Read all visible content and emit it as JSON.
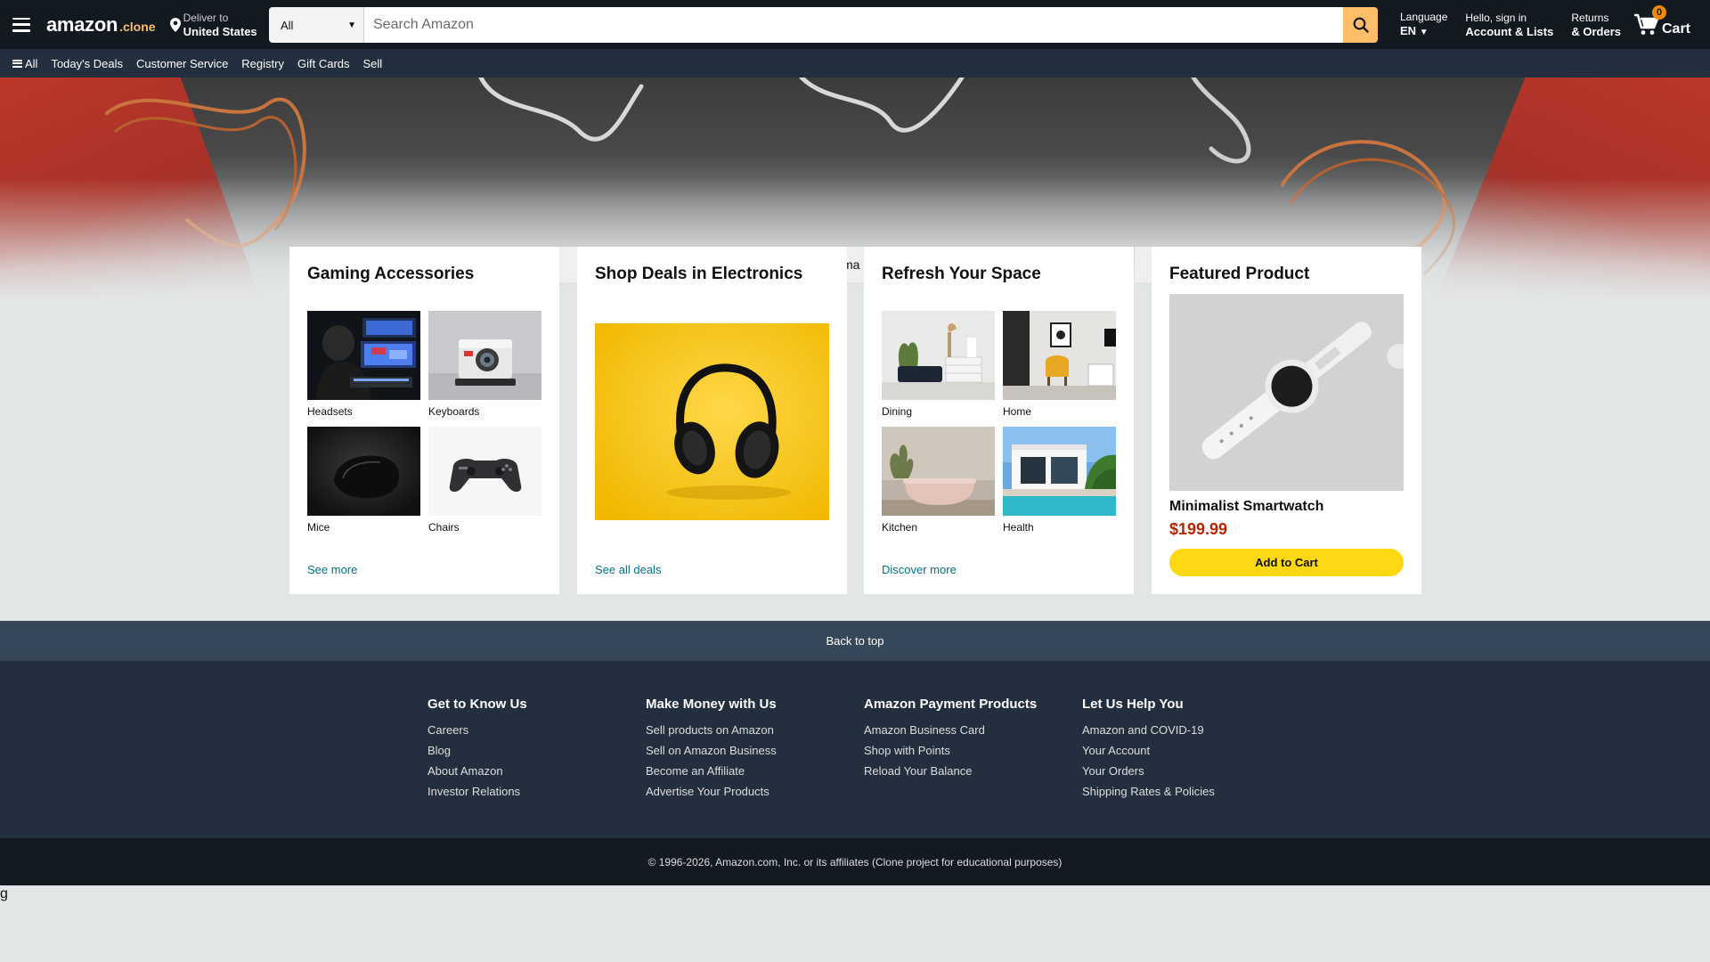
{
  "header": {
    "logo_word": "amazon",
    "logo_suffix": ".clone",
    "deliver_line1": "Deliver to",
    "deliver_line2": "United States",
    "search_category": "All",
    "search_placeholder": "Search Amazon",
    "language_line1": "Language",
    "language_line2": "EN",
    "account_line1": "Hello, sign in",
    "account_line2": "Account & Lists",
    "returns_line1": "Returns",
    "returns_line2": "& Orders",
    "cart_count": "0",
    "cart_label": "Cart"
  },
  "subnav": {
    "items": [
      "All",
      "Today's Deals",
      "Customer Service",
      "Registry",
      "Gift Cards",
      "Sell"
    ]
  },
  "hero": {
    "ghost_text": "ma"
  },
  "cards": {
    "gaming": {
      "title": "Gaming Accessories",
      "tiles": [
        "Headsets",
        "Keyboards",
        "Mice",
        "Chairs"
      ],
      "link": "See more"
    },
    "electronics": {
      "title": "Shop Deals in Electronics",
      "link": "See all deals"
    },
    "space": {
      "title": "Refresh Your Space",
      "tiles": [
        "Dining",
        "Home",
        "Kitchen",
        "Health"
      ],
      "link": "Discover more"
    },
    "featured": {
      "title": "Featured Product",
      "product_name": "Minimalist Smartwatch",
      "price": "$199.99",
      "button": "Add to Cart"
    }
  },
  "footer": {
    "back_to_top": "Back to top",
    "columns": [
      {
        "heading": "Get to Know Us",
        "links": [
          "Careers",
          "Blog",
          "About Amazon",
          "Investor Relations"
        ]
      },
      {
        "heading": "Make Money with Us",
        "links": [
          "Sell products on Amazon",
          "Sell on Amazon Business",
          "Become an Affiliate",
          "Advertise Your Products"
        ]
      },
      {
        "heading": "Amazon Payment Products",
        "links": [
          "Amazon Business Card",
          "Shop with Points",
          "Reload Your Balance"
        ]
      },
      {
        "heading": "Let Us Help You",
        "links": [
          "Amazon and COVID-19",
          "Your Account",
          "Your Orders",
          "Shipping Rates & Policies"
        ]
      }
    ],
    "copyright": "© 1996-2026, Amazon.com, Inc. or its affiliates (Clone project for educational purposes)"
  },
  "stray_text": "g",
  "colors": {
    "nav_dark": "#131921",
    "subnav": "#232f3e",
    "search_button": "#febd69",
    "link": "#007185",
    "price": "#b12704",
    "add_to_cart": "#ffd814",
    "cart_badge": "#f08804"
  }
}
